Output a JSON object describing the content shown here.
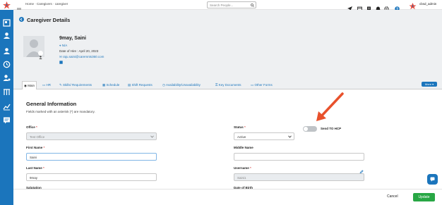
{
  "topbar": {
    "breadcrumb": "Home · Caregivers · caregiver",
    "search_placeholder": "Search People...",
    "user": "cbsd_admin"
  },
  "header": {
    "title": "Caregiver Details",
    "name": "9may, Saini",
    "id": "N/A",
    "date_of_hire": "Date of Hire : April 20, 2023",
    "email": "raju.saini@caremnts360.com"
  },
  "tabs": [
    {
      "label": "Main",
      "icon": "user-circle-icon"
    },
    {
      "label": "HR",
      "icon": "folder-icon"
    },
    {
      "label": "Skills/ Requirements",
      "icon": "wrench-icon"
    },
    {
      "label": "Schedule",
      "icon": "calendar-icon"
    },
    {
      "label": "Shift Requests",
      "icon": "document-icon"
    },
    {
      "label": "Availability/Unavailability",
      "icon": "clock-icon"
    },
    {
      "label": "Key Documents",
      "icon": "key-icon"
    },
    {
      "label": "Other Forms",
      "icon": "folder-icon"
    }
  ],
  "more_label": "More ▾",
  "form": {
    "section_title": "General Information",
    "note": "Fields marked with an asterisk (*) are mandatory.",
    "office_label": "Office",
    "office_value": "Test Office",
    "status_label": "Status",
    "status_value": "Active",
    "send_hcp_label": "Send TO HCP",
    "send_hcp_on": false,
    "first_name_label": "First Name",
    "first_name_value": "Saini",
    "middle_name_label": "Middle Name",
    "middle_name_value": "",
    "last_name_label": "Last Name",
    "last_name_value": "9may",
    "username_label": "Username",
    "username_value": "Saini1",
    "salutation_label": "Salutation",
    "dob_label": "Date of Birth",
    "required_mark": "*"
  },
  "footer": {
    "cancel_label": "Cancel",
    "update_label": "Update"
  },
  "colors": {
    "primary": "#1b75bc",
    "success": "#28a745",
    "arrow": "#e8512c"
  }
}
